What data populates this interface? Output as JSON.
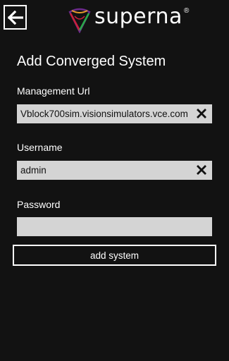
{
  "header": {
    "back_icon": "arrow-left-icon",
    "logo_text": "superna",
    "logo_registered": "®",
    "logo_icon": "superna-logo-mark"
  },
  "form": {
    "title": "Add Converged System",
    "management_url": {
      "label": "Management Url",
      "value": "Vblock700sim.visionsimulators.vce.com",
      "clear_icon": "clear-x-icon"
    },
    "username": {
      "label": "Username",
      "value": "admin",
      "clear_icon": "clear-x-icon"
    },
    "password": {
      "label": "Password",
      "value": ""
    },
    "submit_label": "add system"
  },
  "colors": {
    "background": "#121212",
    "input_background": "#d4d4d4",
    "text": "#ffffff",
    "logo_red": "#c8203c",
    "logo_green": "#2aa84a",
    "logo_purple": "#6b2a8c",
    "logo_orange": "#e89a2c"
  }
}
